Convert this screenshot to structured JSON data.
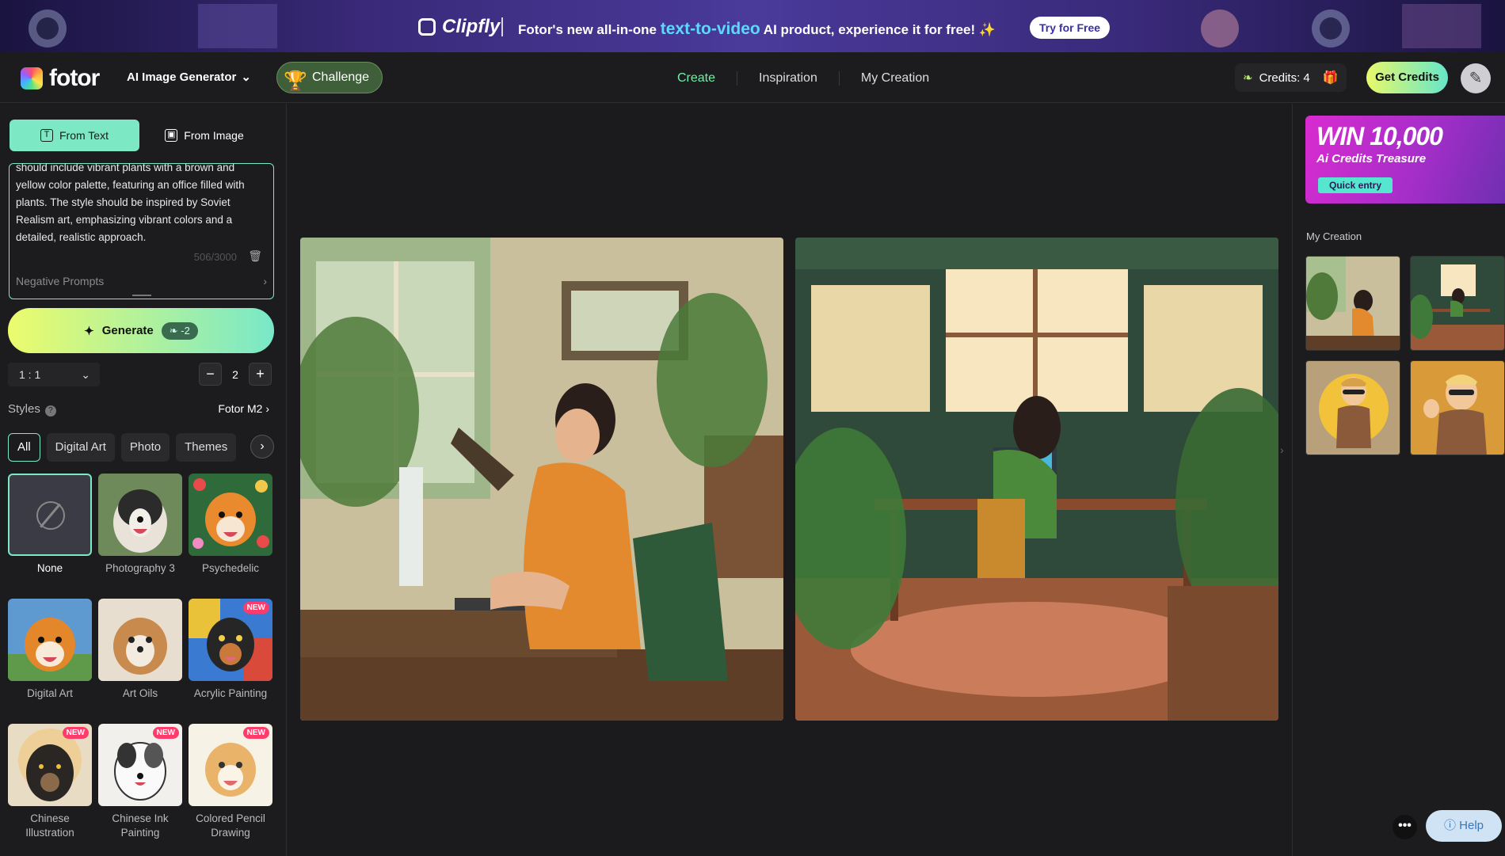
{
  "banner": {
    "brand": "Clipfly",
    "message_pre": "Fotor's new all-in-one ",
    "message_highlight": "text-to-video",
    "message_post": " AI product, experience it for free! ✨",
    "cta": "Try for Free"
  },
  "header": {
    "logo": "fotor",
    "product_menu": "AI Image Generator",
    "challenge": "Challenge",
    "nav": [
      "Create",
      "Inspiration",
      "My Creation"
    ],
    "credits": "Credits: 4",
    "get_credits": "Get Credits"
  },
  "sidebar": {
    "tabs": [
      {
        "label": "From Text",
        "active": true
      },
      {
        "label": "From Image",
        "active": false
      }
    ],
    "prompt_text": "should include vibrant plants with a brown and yellow color palette, featuring an office filled with plants. The style should be inspired by Soviet Realism art, emphasizing vibrant colors and a detailed, realistic approach.",
    "char_count": "506/3000",
    "negative_prompts": "Negative Prompts",
    "generate": {
      "label": "Generate",
      "cost": "-2"
    },
    "ratio": "1 : 1",
    "count": "2",
    "styles_label": "Styles",
    "model": "Fotor M2",
    "categories": [
      "All",
      "Digital Art",
      "Photo",
      "Themes"
    ],
    "style_items": [
      {
        "label": "None",
        "new": false
      },
      {
        "label": "Photography 3",
        "new": false
      },
      {
        "label": "Psychedelic",
        "new": false
      },
      {
        "label": "Digital Art",
        "new": false
      },
      {
        "label": "Art Oils",
        "new": false
      },
      {
        "label": "Acrylic Painting",
        "new": true
      },
      {
        "label": "Chinese Illustration",
        "new": true
      },
      {
        "label": "Chinese Ink Painting",
        "new": true
      },
      {
        "label": "Colored Pencil Drawing",
        "new": true
      }
    ],
    "new_badge": "NEW"
  },
  "right_panel": {
    "promo_title": "WIN 10,000",
    "promo_subtitle": "Ai Credits Treasure",
    "promo_cta": "Quick entry",
    "my_creation": "My Creation"
  },
  "help": "Help",
  "colors": {
    "accent": "#7ce8c4",
    "nav_active": "#6ff0a6",
    "new_badge": "#ff3b6b"
  }
}
